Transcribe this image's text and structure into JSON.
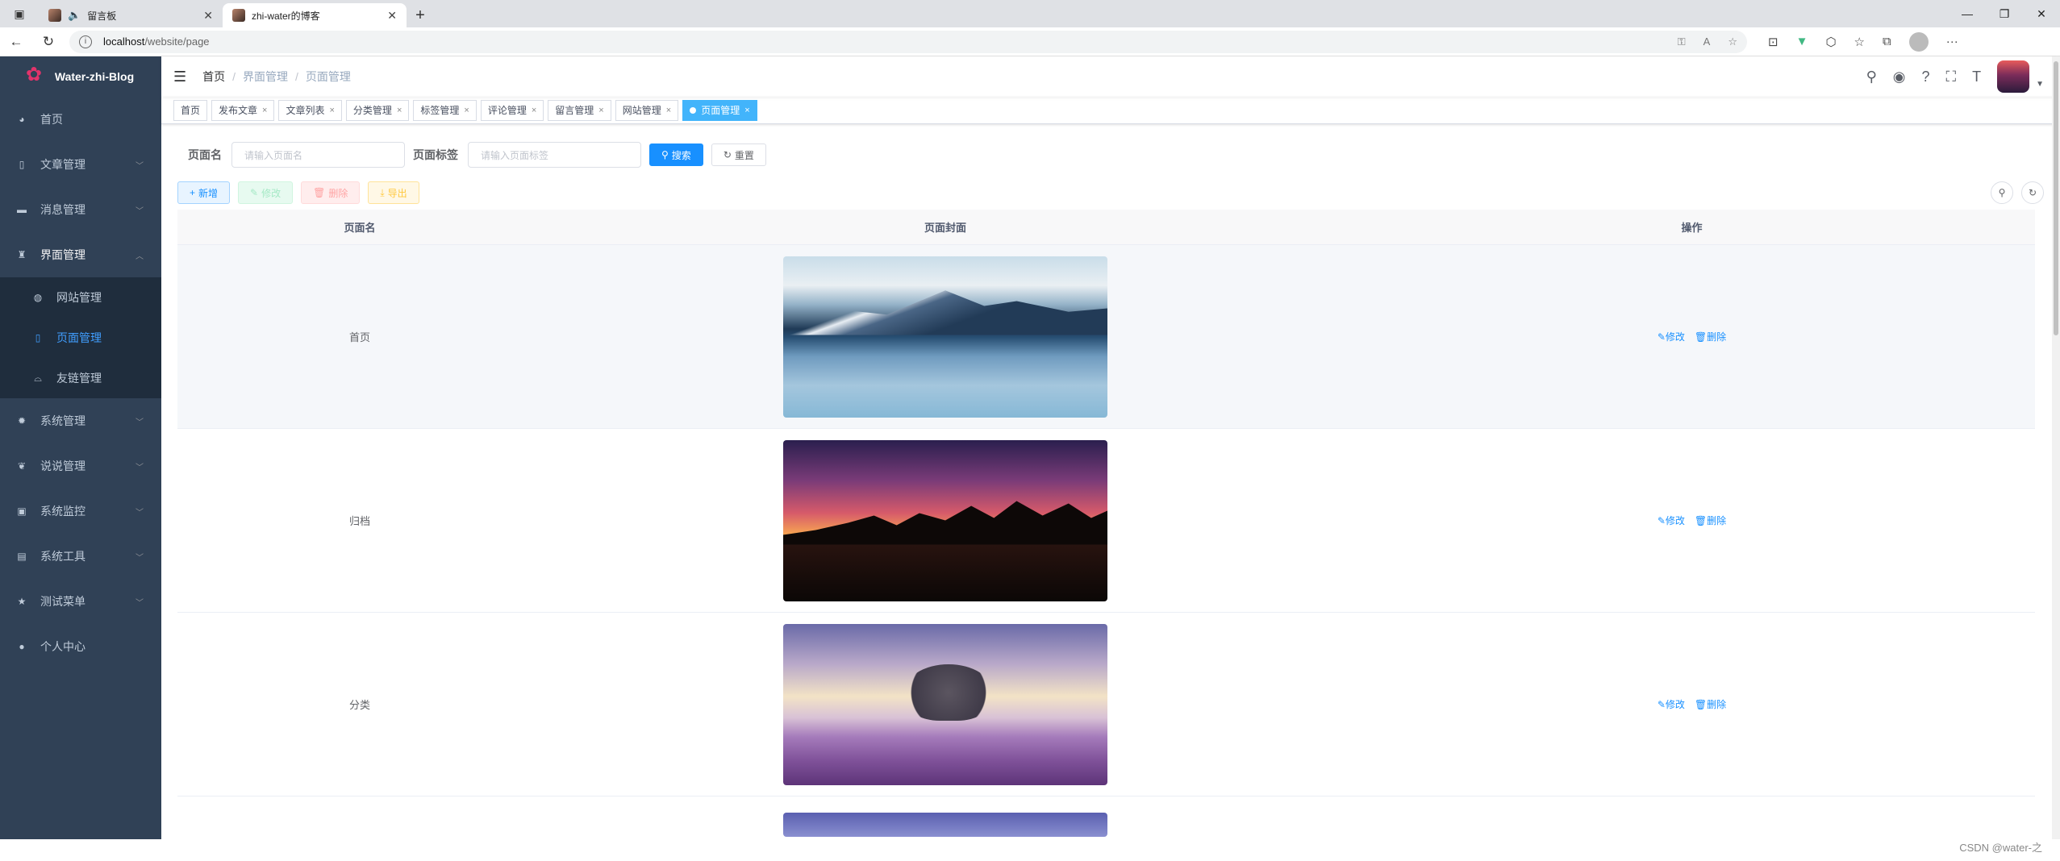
{
  "browser": {
    "tabs": [
      {
        "title": "留言板",
        "active": false,
        "audio": true
      },
      {
        "title": "zhi-water的博客",
        "active": true,
        "audio": false
      }
    ],
    "url_host": "localhost",
    "url_path": "/website/page"
  },
  "sidebar": {
    "logo": "Water-zhi-Blog",
    "items": [
      {
        "label": "首页",
        "icon": "dashboard-icon",
        "glyph": "◕",
        "expandable": false
      },
      {
        "label": "文章管理",
        "icon": "book-icon",
        "glyph": "▯",
        "expandable": true
      },
      {
        "label": "消息管理",
        "icon": "message-icon",
        "glyph": "▬",
        "expandable": true
      },
      {
        "label": "界面管理",
        "icon": "shirt-icon",
        "glyph": "♜",
        "expandable": true,
        "open": true,
        "children": [
          {
            "label": "网站管理",
            "icon": "globe-icon",
            "glyph": "◍"
          },
          {
            "label": "页面管理",
            "icon": "book-icon",
            "glyph": "▯",
            "active": true
          },
          {
            "label": "友链管理",
            "icon": "link-icon",
            "glyph": "⌓"
          }
        ]
      },
      {
        "label": "系统管理",
        "icon": "gear-icon",
        "glyph": "✹",
        "expandable": true
      },
      {
        "label": "说说管理",
        "icon": "chat-icon",
        "glyph": "❦",
        "expandable": true
      },
      {
        "label": "系统监控",
        "icon": "monitor-icon",
        "glyph": "▣",
        "expandable": true
      },
      {
        "label": "系统工具",
        "icon": "toolbox-icon",
        "glyph": "▤",
        "expandable": true
      },
      {
        "label": "测试菜单",
        "icon": "star-icon",
        "glyph": "★",
        "expandable": true
      },
      {
        "label": "个人中心",
        "icon": "user-icon",
        "glyph": "●",
        "expandable": false
      }
    ]
  },
  "navbar": {
    "breadcrumb": [
      "首页",
      "界面管理",
      "页面管理"
    ]
  },
  "tagsview": [
    {
      "label": "首页",
      "closable": false
    },
    {
      "label": "发布文章",
      "closable": true
    },
    {
      "label": "文章列表",
      "closable": true
    },
    {
      "label": "分类管理",
      "closable": true
    },
    {
      "label": "标签管理",
      "closable": true
    },
    {
      "label": "评论管理",
      "closable": true
    },
    {
      "label": "留言管理",
      "closable": true
    },
    {
      "label": "网站管理",
      "closable": true
    },
    {
      "label": "页面管理",
      "closable": true,
      "active": true
    }
  ],
  "search": {
    "name_label": "页面名",
    "name_placeholder": "请输入页面名",
    "tag_label": "页面标签",
    "tag_placeholder": "请输入页面标签",
    "search_btn": "搜索",
    "reset_btn": "重置"
  },
  "toolbar": {
    "add": "新增",
    "edit": "修改",
    "delete": "删除",
    "export": "导出"
  },
  "table": {
    "headers": [
      "页面名",
      "页面封面",
      "操作"
    ],
    "rows": [
      {
        "name": "首页",
        "cover": "mountain-lake-image",
        "edit": "修改",
        "delete": "删除"
      },
      {
        "name": "归档",
        "cover": "sunset-trees-image",
        "edit": "修改",
        "delete": "删除"
      },
      {
        "name": "分类",
        "cover": "lavender-tree-image",
        "edit": "修改",
        "delete": "删除"
      }
    ]
  },
  "watermark": "CSDN @water-之"
}
